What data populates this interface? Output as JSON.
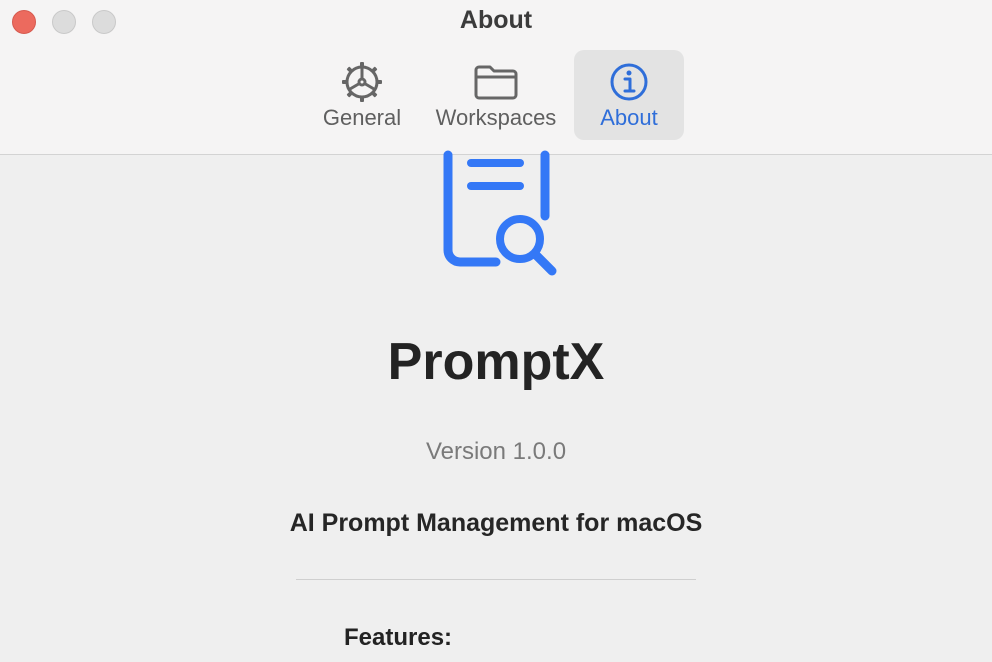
{
  "window": {
    "title": "About"
  },
  "tabs": [
    {
      "label": "General",
      "icon": "gear-icon",
      "selected": false
    },
    {
      "label": "Workspaces",
      "icon": "folder-icon",
      "selected": false
    },
    {
      "label": "About",
      "icon": "info-icon",
      "selected": true
    }
  ],
  "app": {
    "name": "PromptX",
    "version": "Version 1.0.0",
    "tagline": "AI Prompt Management for macOS",
    "icon": "document-search-icon"
  },
  "features": {
    "heading": "Features:"
  },
  "colors": {
    "accent": "#2f6ed9",
    "icon_blue": "#3478f6",
    "close": "#ec6a5e"
  }
}
